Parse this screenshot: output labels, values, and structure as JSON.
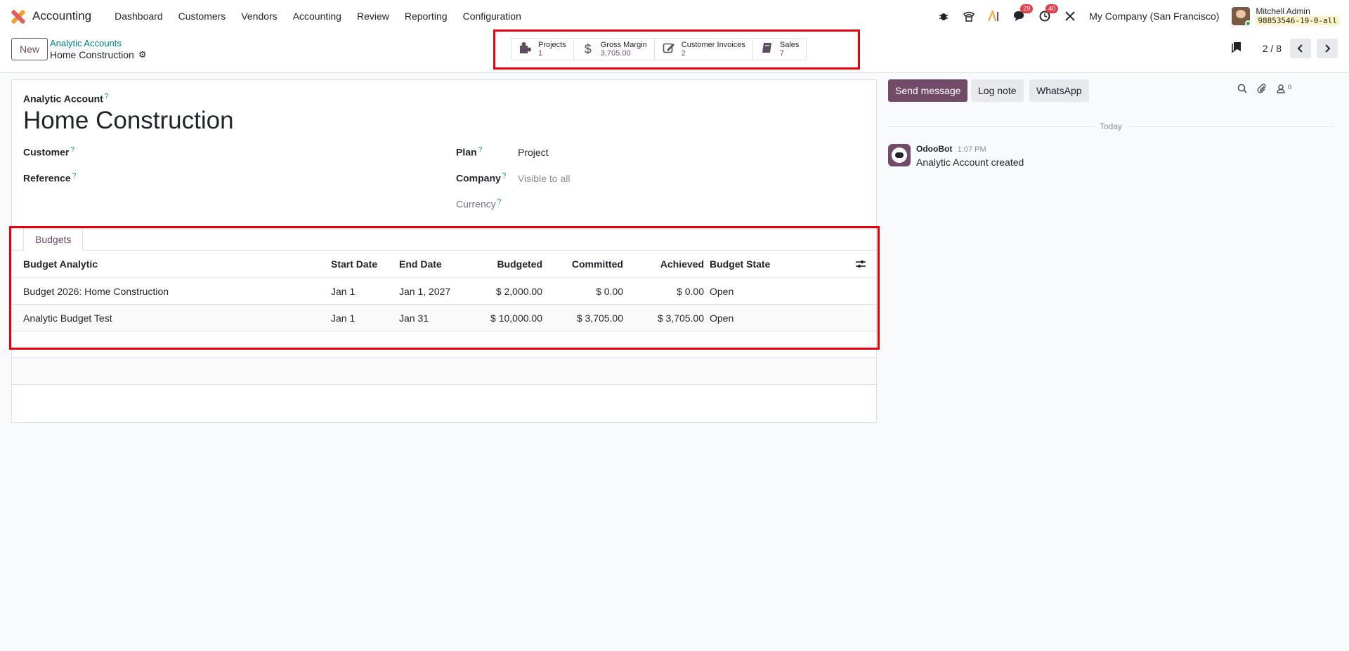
{
  "navbar": {
    "app_name": "Accounting",
    "menu": [
      "Dashboard",
      "Customers",
      "Vendors",
      "Accounting",
      "Review",
      "Reporting",
      "Configuration"
    ],
    "messages_badge": "29",
    "activities_badge": "40",
    "company": "My Company (San Francisco)",
    "user_name": "Mitchell Admin",
    "database": "98853546-19-0-all"
  },
  "control_panel": {
    "new_label": "New",
    "breadcrumb_parent": "Analytic Accounts",
    "breadcrumb_current": "Home Construction",
    "pager_value": "2 / 8"
  },
  "smart_buttons": [
    {
      "label": "Projects",
      "value": "1",
      "icon": "puzzle-icon"
    },
    {
      "label": "Gross Margin",
      "value": "3,705.00",
      "icon": "dollar-icon"
    },
    {
      "label": "Customer Invoices",
      "value": "2",
      "icon": "edit-icon"
    },
    {
      "label": "Sales",
      "value": "7",
      "icon": "book-icon"
    }
  ],
  "form": {
    "account_label": "Analytic Account",
    "account_name": "Home Construction",
    "customer_label": "Customer",
    "reference_label": "Reference",
    "plan_label": "Plan",
    "plan_value": "Project",
    "company_label": "Company",
    "company_placeholder": "Visible to all",
    "currency_label": "Currency",
    "help_mark": "?"
  },
  "budgets": {
    "tab_label": "Budgets",
    "columns": [
      "Budget Analytic",
      "Start Date",
      "End Date",
      "Budgeted",
      "Committed",
      "Achieved",
      "Budget State"
    ],
    "rows": [
      {
        "name": "Budget 2026: Home Construction",
        "start": "Jan 1",
        "end": "Jan 1, 2027",
        "budgeted": "$ 2,000.00",
        "committed": "$ 0.00",
        "achieved": "$ 0.00",
        "state": "Open"
      },
      {
        "name": "Analytic Budget Test",
        "start": "Jan 1",
        "end": "Jan 31",
        "budgeted": "$ 10,000.00",
        "committed": "$ 3,705.00",
        "achieved": "$ 3,705.00",
        "state": "Open"
      }
    ]
  },
  "chatter": {
    "send_label": "Send message",
    "note_label": "Log note",
    "whatsapp_label": "WhatsApp",
    "followers_count": "0",
    "today_label": "Today",
    "message": {
      "author": "OdooBot",
      "time": "1:07 PM",
      "body": "Analytic Account created"
    }
  },
  "colors": {
    "brand": "#714b67",
    "link": "#017e84",
    "highlight": "#e6000b"
  }
}
